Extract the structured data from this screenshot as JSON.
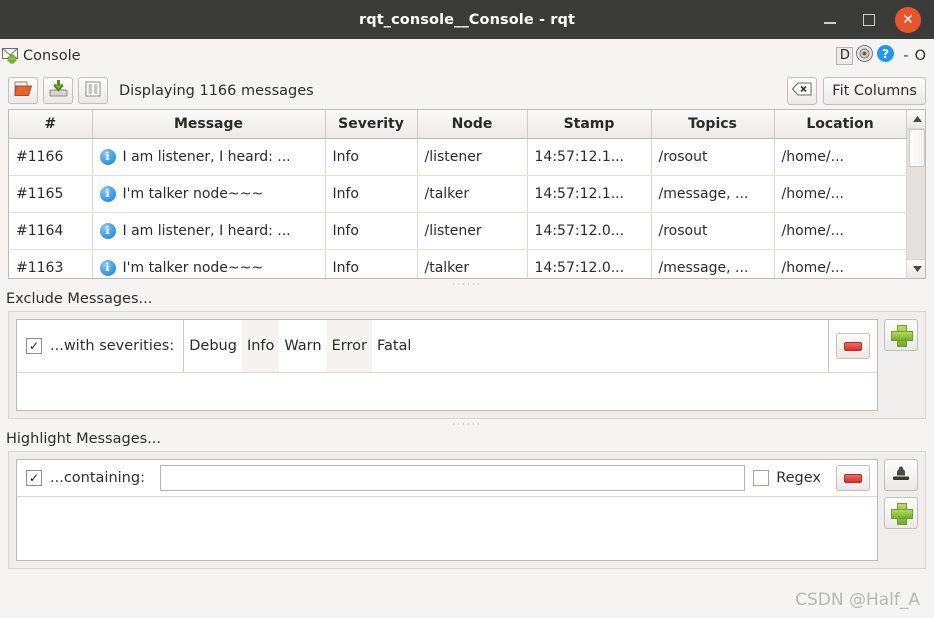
{
  "window": {
    "title": "rqt_console__Console - rqt",
    "minimize_label": "minimize",
    "maximize_label": "maximize",
    "close_label": "close"
  },
  "dock": {
    "title": "Console",
    "icon": "envelope-add-icon",
    "d_label": "D",
    "separator": "-",
    "o_label": "O"
  },
  "toolbar": {
    "open_icon": "folder-open-icon",
    "save_icon": "save-down-icon",
    "pause_icon": "pause-icon",
    "status_text": "Displaying 1166 messages",
    "clear_icon": "clear-backspace-icon",
    "fit_columns_label": "Fit Columns"
  },
  "table": {
    "columns": [
      "#",
      "Message",
      "Severity",
      "Node",
      "Stamp",
      "Topics",
      "Location"
    ],
    "rows": [
      {
        "num": "#1166",
        "message": "I am listener, I heard: ...",
        "severity": "Info",
        "node": "/listener",
        "stamp": "14:57:12.1...",
        "topics": "/rosout",
        "location": "/home/..."
      },
      {
        "num": "#1165",
        "message": "I'm talker node~~~",
        "severity": "Info",
        "node": "/talker",
        "stamp": "14:57:12.1...",
        "topics": "/message, ...",
        "location": "/home/..."
      },
      {
        "num": "#1164",
        "message": "I am listener, I heard: ...",
        "severity": "Info",
        "node": "/listener",
        "stamp": "14:57:12.0...",
        "topics": "/rosout",
        "location": "/home/..."
      },
      {
        "num": "#1163",
        "message": "I'm talker node~~~",
        "severity": "Info",
        "node": "/talker",
        "stamp": "14:57:12.0...",
        "topics": "/message, ...",
        "location": "/home/..."
      }
    ],
    "severity_color": "#3b3bc4",
    "info_badge": "i"
  },
  "exclude": {
    "section_label": "Exclude Messages...",
    "checkbox_checked": true,
    "check_glyph": "✓",
    "row_label": "...with severities:",
    "severities": [
      "Debug",
      "Info",
      "Warn",
      "Error",
      "Fatal"
    ],
    "remove_icon": "minus-icon",
    "add_icon": "plus-icon"
  },
  "highlight": {
    "section_label": "Highlight Messages...",
    "checkbox_checked": true,
    "check_glyph": "✓",
    "row_label": "...containing:",
    "input_value": "",
    "input_placeholder": "",
    "regex_label": "Regex",
    "regex_checked": false,
    "remove_icon": "minus-icon",
    "stamp_icon": "stamp-icon",
    "add_icon": "plus-icon"
  },
  "watermark": "CSDN @Half_A",
  "colors": {
    "titlebar_bg": "#3b3b39",
    "close_button": "#e8542c",
    "window_bg": "#f5f4f2",
    "severity_text": "#3b3bc4",
    "accent_green": "#76ad2a",
    "accent_red": "#d6342b"
  }
}
